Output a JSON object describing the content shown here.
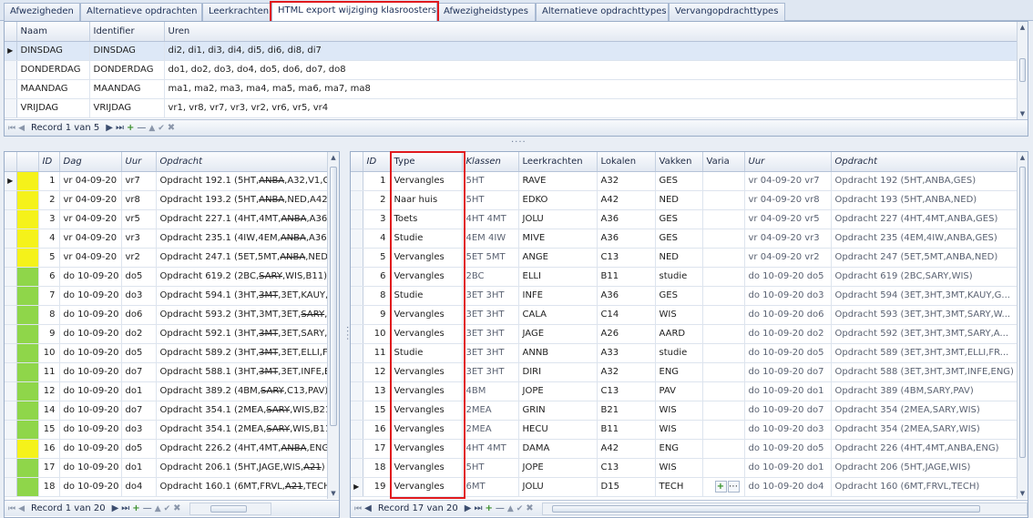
{
  "tabs": [
    {
      "label": "Afwezigheden"
    },
    {
      "label": "Alternatieve opdrachten"
    },
    {
      "label": "Leerkrachten"
    },
    {
      "label": "HTML export wijziging klasroosters"
    },
    {
      "label": "Afwezigheidstypes"
    },
    {
      "label": "Alternatieve opdrachttypes"
    },
    {
      "label": "Vervangopdrachttypes"
    }
  ],
  "top_grid": {
    "columns": [
      "Naam",
      "Identifier",
      "Uren"
    ],
    "rows": [
      {
        "naam": "DINSDAG",
        "identifier": "DINSDAG",
        "uren": "di2, di1, di3, di4, di5, di6, di8, di7"
      },
      {
        "naam": "DONDERDAG",
        "identifier": "DONDERDAG",
        "uren": "do1, do2, do3, do4, do5, do6, do7, do8"
      },
      {
        "naam": "MAANDAG",
        "identifier": "MAANDAG",
        "uren": "ma1, ma2, ma3, ma4, ma5, ma6, ma7, ma8"
      },
      {
        "naam": "VRIJDAG",
        "identifier": "VRIJDAG",
        "uren": "vr1, vr8, vr7, vr3, vr2, vr6, vr5, vr4"
      }
    ],
    "record_label": "Record 1 van 5"
  },
  "left_grid": {
    "columns": [
      "ID",
      "Dag",
      "Uur",
      "Opdracht"
    ],
    "rows": [
      {
        "id": "1",
        "dag": "vr 04-09-20",
        "uur": "vr7",
        "pre": "Opdracht 192.1 (5HT,",
        "strike": "ANBA",
        "post": ",A32,V1,GES)",
        "color": "yellow"
      },
      {
        "id": "2",
        "dag": "vr 04-09-20",
        "uur": "vr8",
        "pre": "Opdracht 193.2 (5HT,",
        "strike": "ANBA",
        "post": ",NED,A42)",
        "color": "yellow"
      },
      {
        "id": "3",
        "dag": "vr 04-09-20",
        "uur": "vr5",
        "pre": "Opdracht 227.1 (4HT,4MT,",
        "strike": "ANBA",
        "post": ",A36,GES)",
        "color": "yellow"
      },
      {
        "id": "4",
        "dag": "vr 04-09-20",
        "uur": "vr3",
        "pre": "Opdracht 235.1 (4IW,4EM,",
        "strike": "ANBA",
        "post": ",A36,GES)",
        "color": "yellow"
      },
      {
        "id": "5",
        "dag": "vr 04-09-20",
        "uur": "vr2",
        "pre": "Opdracht 247.1 (5ET,5MT,",
        "strike": "ANBA",
        "post": ",NED,C13)",
        "color": "yellow"
      },
      {
        "id": "6",
        "dag": "do 10-09-20",
        "uur": "do5",
        "pre": "Opdracht 619.2 (2BC,",
        "strike": "SARY",
        "post": ",WIS,B11)",
        "color": "green"
      },
      {
        "id": "7",
        "dag": "do 10-09-20",
        "uur": "do3",
        "pre": "Opdracht 594.1 (3HT,",
        "strike": "3MT",
        "post": ",3ET,KAUY,A36)",
        "color": "green"
      },
      {
        "id": "8",
        "dag": "do 10-09-20",
        "uur": "do6",
        "pre": "Opdracht 593.2 (3HT,3MT,3ET,",
        "strike": "SARY",
        "post": ",WIS)",
        "color": "green"
      },
      {
        "id": "9",
        "dag": "do 10-09-20",
        "uur": "do2",
        "pre": "Opdracht 592.1 (3HT,",
        "strike": "3MT",
        "post": ",3ET,SARY,A26)",
        "color": "green"
      },
      {
        "id": "10",
        "dag": "do 10-09-20",
        "uur": "do5",
        "pre": "Opdracht 589.2 (3HT,",
        "strike": "3MT",
        "post": ",3ET,ELLI,FR)",
        "color": "green"
      },
      {
        "id": "11",
        "dag": "do 10-09-20",
        "uur": "do7",
        "pre": "Opdracht 588.1 (3HT,",
        "strike": "3MT",
        "post": ",3ET,INFE,ENG)",
        "color": "green"
      },
      {
        "id": "12",
        "dag": "do 10-09-20",
        "uur": "do1",
        "pre": "Opdracht 389.2 (4BM,",
        "strike": "SARY",
        "post": ",C13,PAV)",
        "color": "green"
      },
      {
        "id": "14",
        "dag": "do 10-09-20",
        "uur": "do7",
        "pre": "Opdracht 354.1 (2MEA,",
        "strike": "SARY",
        "post": ",WIS,B21)",
        "color": "green"
      },
      {
        "id": "15",
        "dag": "do 10-09-20",
        "uur": "do3",
        "pre": "Opdracht 354.1 (2MEA,",
        "strike": "SARY",
        "post": ",WIS,B11)",
        "color": "green"
      },
      {
        "id": "16",
        "dag": "do 10-09-20",
        "uur": "do5",
        "pre": "Opdracht 226.2 (4HT,4MT,",
        "strike": "ANBA",
        "post": ",ENG,A42)",
        "color": "yellow"
      },
      {
        "id": "17",
        "dag": "do 10-09-20",
        "uur": "do1",
        "pre": "Opdracht 206.1 (5HT,JAGE,WIS,",
        "strike": "A21",
        "post": ")",
        "color": "green"
      },
      {
        "id": "18",
        "dag": "do 10-09-20",
        "uur": "do4",
        "pre": "Opdracht 160.1 (6MT,FRVL,",
        "strike": "A21",
        "post": ",TECH)",
        "color": "green"
      }
    ],
    "record_label": "Record 1 van 20"
  },
  "right_grid": {
    "columns": [
      "ID",
      "Type",
      "Klassen",
      "Leerkrachten",
      "Lokalen",
      "Vakken",
      "Varia",
      "Uur",
      "Opdracht"
    ],
    "rows": [
      {
        "id": "1",
        "type": "Vervangles",
        "klassen": "5HT",
        "leerkrachten": "RAVE",
        "lokalen": "A32",
        "vakken": "GES",
        "varia": "",
        "uur": "vr 04-09-20 vr7",
        "opdracht": "Opdracht 192 (5HT,ANBA,GES)"
      },
      {
        "id": "2",
        "type": "Naar huis",
        "klassen": "5HT",
        "leerkrachten": "EDKO",
        "lokalen": "A42",
        "vakken": "NED",
        "varia": "",
        "uur": "vr 04-09-20 vr8",
        "opdracht": "Opdracht 193 (5HT,ANBA,NED)"
      },
      {
        "id": "3",
        "type": "Toets",
        "klassen": "4HT 4MT",
        "leerkrachten": "JOLU",
        "lokalen": "A36",
        "vakken": "GES",
        "varia": "",
        "uur": "vr 04-09-20 vr5",
        "opdracht": "Opdracht 227 (4HT,4MT,ANBA,GES)"
      },
      {
        "id": "4",
        "type": "Studie",
        "klassen": "4EM 4IW",
        "leerkrachten": "MIVE",
        "lokalen": "A36",
        "vakken": "GES",
        "varia": "",
        "uur": "vr 04-09-20 vr3",
        "opdracht": "Opdracht 235 (4EM,4IW,ANBA,GES)"
      },
      {
        "id": "5",
        "type": "Vervangles",
        "klassen": "5ET 5MT",
        "leerkrachten": "ANGE",
        "lokalen": "C13",
        "vakken": "NED",
        "varia": "",
        "uur": "vr 04-09-20 vr2",
        "opdracht": "Opdracht 247 (5ET,5MT,ANBA,NED)"
      },
      {
        "id": "6",
        "type": "Vervangles",
        "klassen": "2BC",
        "leerkrachten": "ELLI",
        "lokalen": "B11",
        "vakken": "studie",
        "varia": "",
        "uur": "do 10-09-20 do5",
        "opdracht": "Opdracht 619 (2BC,SARY,WIS)"
      },
      {
        "id": "8",
        "type": "Studie",
        "klassen": "3ET 3HT",
        "leerkrachten": "INFE",
        "lokalen": "A36",
        "vakken": "GES",
        "varia": "",
        "uur": "do 10-09-20 do3",
        "opdracht": "Opdracht 594 (3ET,3HT,3MT,KAUY,G..."
      },
      {
        "id": "9",
        "type": "Vervangles",
        "klassen": "3ET 3HT",
        "leerkrachten": "CALA",
        "lokalen": "C14",
        "vakken": "WIS",
        "varia": "",
        "uur": "do 10-09-20 do6",
        "opdracht": "Opdracht 593 (3ET,3HT,3MT,SARY,W..."
      },
      {
        "id": "10",
        "type": "Vervangles",
        "klassen": "3ET 3HT",
        "leerkrachten": "JAGE",
        "lokalen": "A26",
        "vakken": "AARD",
        "varia": "",
        "uur": "do 10-09-20 do2",
        "opdracht": "Opdracht 592 (3ET,3HT,3MT,SARY,A..."
      },
      {
        "id": "11",
        "type": "Studie",
        "klassen": "3ET 3HT",
        "leerkrachten": "ANNB",
        "lokalen": "A33",
        "vakken": "studie",
        "varia": "",
        "uur": "do 10-09-20 do5",
        "opdracht": "Opdracht 589 (3ET,3HT,3MT,ELLI,FR..."
      },
      {
        "id": "12",
        "type": "Vervangles",
        "klassen": "3ET 3HT",
        "leerkrachten": "DIRI",
        "lokalen": "A32",
        "vakken": "ENG",
        "varia": "",
        "uur": "do 10-09-20 do7",
        "opdracht": "Opdracht 588 (3ET,3HT,3MT,INFE,ENG)"
      },
      {
        "id": "13",
        "type": "Vervangles",
        "klassen": "4BM",
        "leerkrachten": "JOPE",
        "lokalen": "C13",
        "vakken": "PAV",
        "varia": "",
        "uur": "do 10-09-20 do1",
        "opdracht": "Opdracht 389 (4BM,SARY,PAV)"
      },
      {
        "id": "15",
        "type": "Vervangles",
        "klassen": "2MEA",
        "leerkrachten": "GRIN",
        "lokalen": "B21",
        "vakken": "WIS",
        "varia": "",
        "uur": "do 10-09-20 do7",
        "opdracht": "Opdracht 354 (2MEA,SARY,WIS)"
      },
      {
        "id": "16",
        "type": "Vervangles",
        "klassen": "2MEA",
        "leerkrachten": "HECU",
        "lokalen": "B11",
        "vakken": "WIS",
        "varia": "",
        "uur": "do 10-09-20 do3",
        "opdracht": "Opdracht 354 (2MEA,SARY,WIS)"
      },
      {
        "id": "17",
        "type": "Vervangles",
        "klassen": "4HT 4MT",
        "leerkrachten": "DAMA",
        "lokalen": "A42",
        "vakken": "ENG",
        "varia": "",
        "uur": "do 10-09-20 do5",
        "opdracht": "Opdracht 226 (4HT,4MT,ANBA,ENG)"
      },
      {
        "id": "18",
        "type": "Vervangles",
        "klassen": "5HT",
        "leerkrachten": "JOPE",
        "lokalen": "C13",
        "vakken": "WIS",
        "varia": "",
        "uur": "do 10-09-20 do1",
        "opdracht": "Opdracht 206 (5HT,JAGE,WIS)"
      },
      {
        "id": "19",
        "type": "Vervangles",
        "klassen": "6MT",
        "leerkrachten": "JOLU",
        "lokalen": "D15",
        "vakken": "TECH",
        "varia": "",
        "uur": "do 10-09-20 do4",
        "opdracht": "Opdracht 160 (6MT,FRVL,TECH)"
      }
    ],
    "record_label": "Record 17 van 20"
  },
  "icons": {
    "row_indicator": "row-indicator-arrow-icon",
    "first": "nav-first-icon",
    "prev": "nav-prev-icon",
    "next": "nav-next-icon",
    "last": "nav-last-icon",
    "add": "add-icon",
    "remove": "remove-icon",
    "edit": "edit-icon",
    "accept": "check-icon",
    "cancel": "cancel-icon"
  },
  "colors": {
    "highlight_red": "#e0191d",
    "status_green": "#8fd64a",
    "status_yellow": "#f5f21a",
    "selected_row": "#dde8f7"
  }
}
